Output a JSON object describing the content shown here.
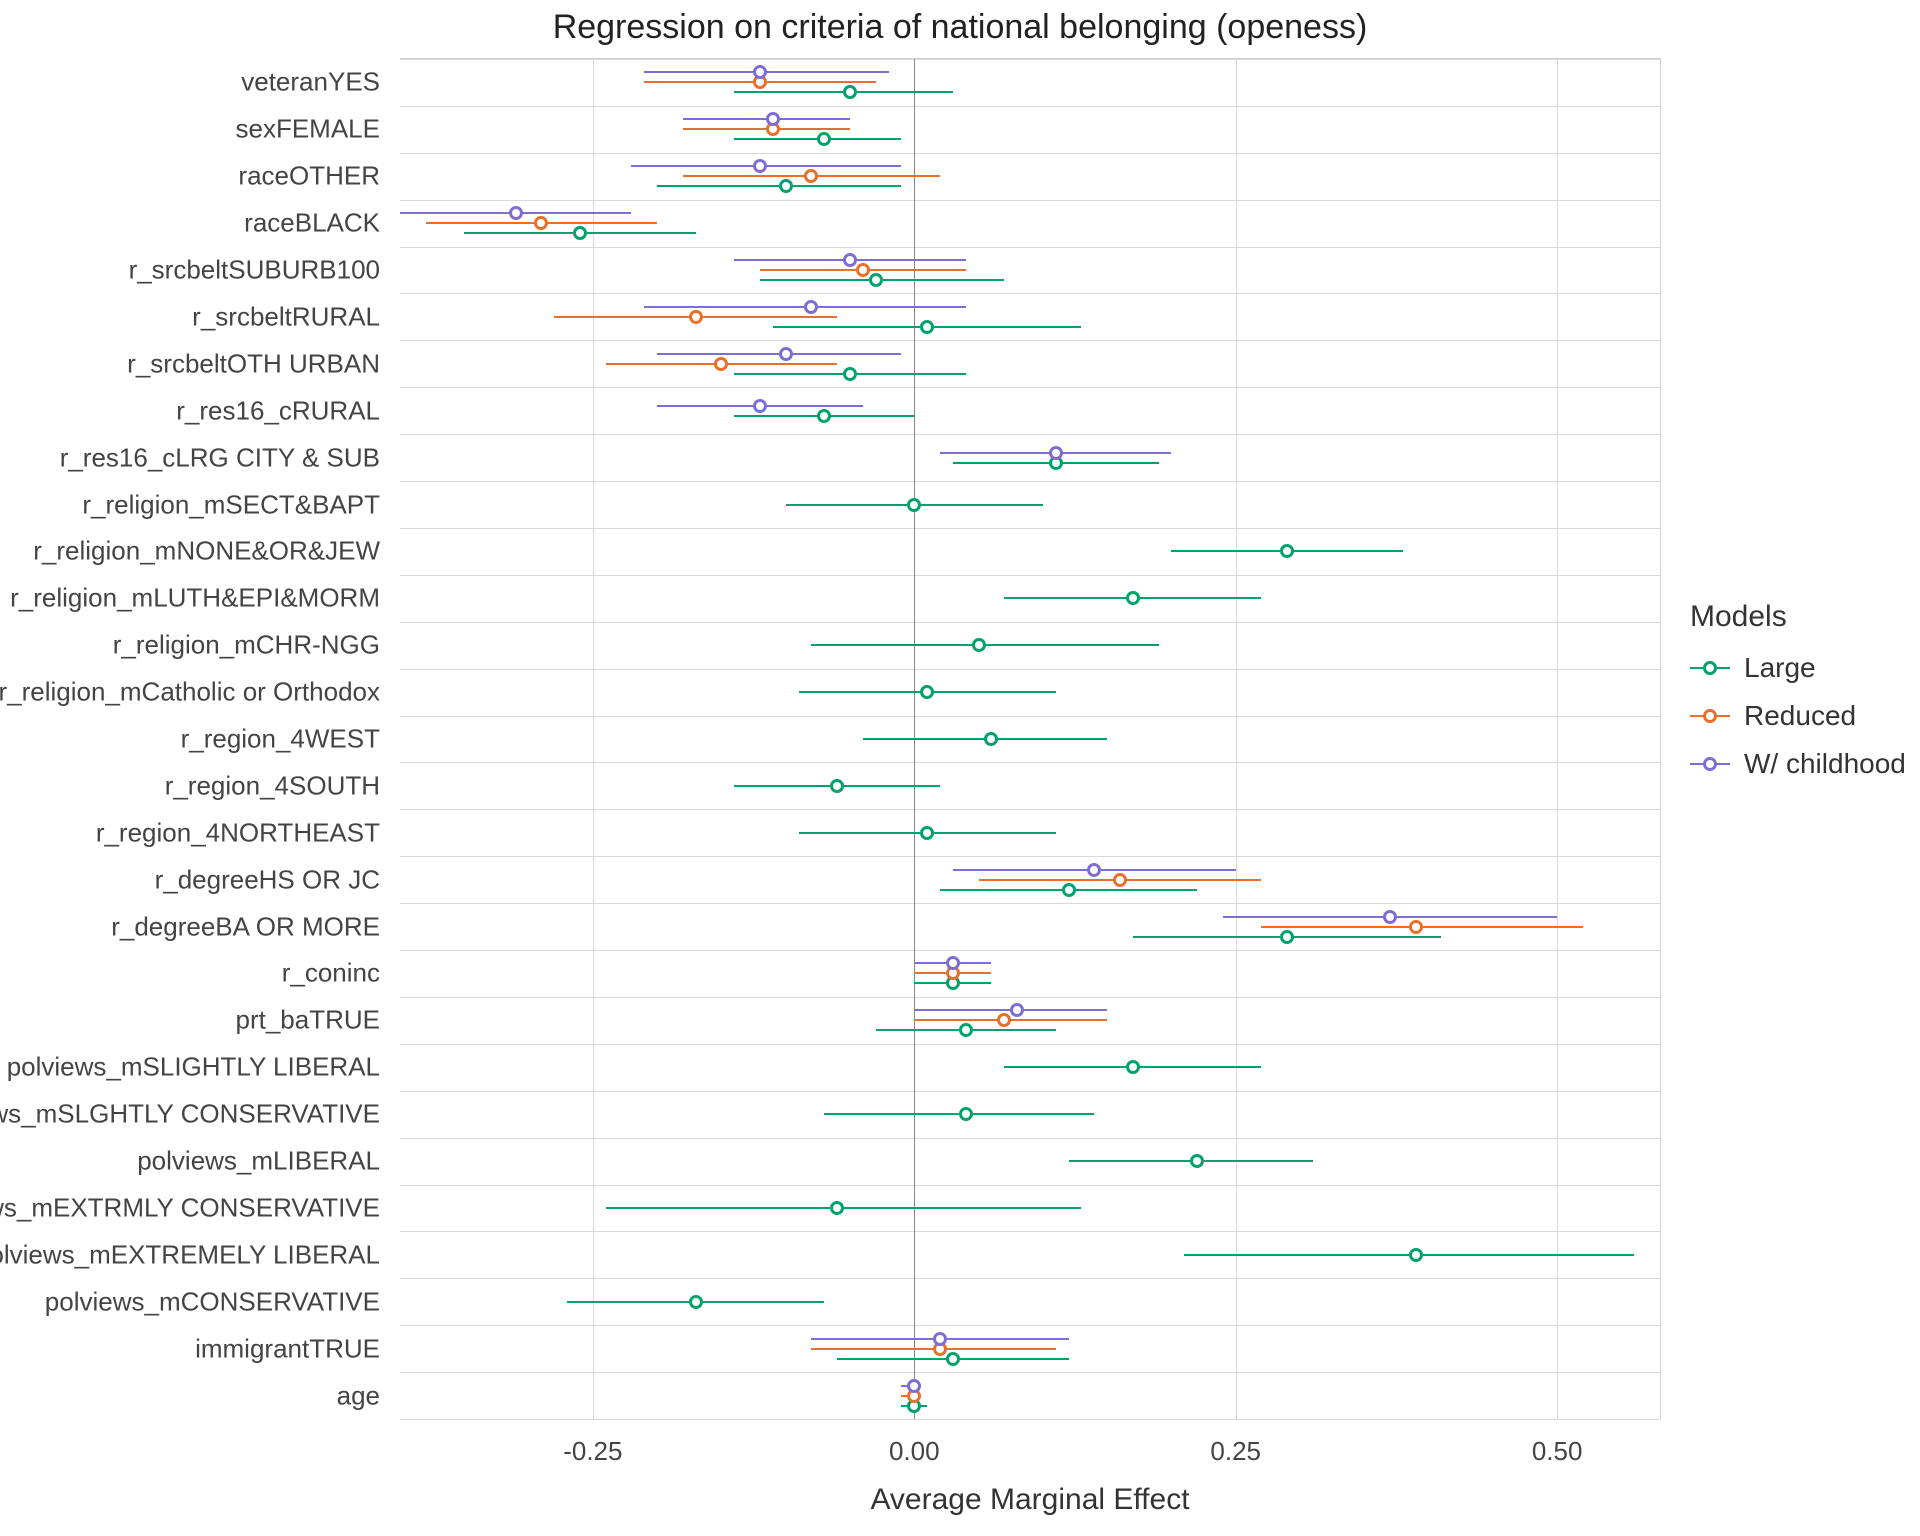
{
  "chart_data": {
    "type": "scatter",
    "title": "Regression on criteria of national belonging (openess)",
    "xlabel": "Average Marginal Effect",
    "ylabel": "",
    "xlim": [
      -0.4,
      0.58
    ],
    "x_ticks": [
      -0.25,
      0.0,
      0.25,
      0.5
    ],
    "categories": [
      "veteranYES",
      "sexFEMALE",
      "raceOTHER",
      "raceBLACK",
      "r_srcbeltSUBURB100",
      "r_srcbeltRURAL",
      "r_srcbeltOTH URBAN",
      "r_res16_cRURAL",
      "r_res16_cLRG CITY & SUB",
      "r_religion_mSECT&BAPT",
      "r_religion_mNONE&OR&JEW",
      "r_religion_mLUTH&EPI&MORM",
      "r_religion_mCHR-NGG",
      "r_religion_mCatholic or Orthodox",
      "r_region_4WEST",
      "r_region_4SOUTH",
      "r_region_4NORTHEAST",
      "r_degreeHS OR JC",
      "r_degreeBA OR MORE",
      "r_coninc",
      "prt_baTRUE",
      "polviews_mSLIGHTLY LIBERAL",
      "polviews_mSLGHTLY CONSERVATIVE",
      "polviews_mLIBERAL",
      "polviews_mEXTRMLY CONSERVATIVE",
      "polviews_mEXTREMELY LIBERAL",
      "polviews_mCONSERVATIVE",
      "immigrantTRUE",
      "age"
    ],
    "series": [
      {
        "name": "Large",
        "color": "#00a36c",
        "points": {
          "veteranYES": {
            "est": -0.05,
            "lo": -0.14,
            "hi": 0.03
          },
          "sexFEMALE": {
            "est": -0.07,
            "lo": -0.14,
            "hi": -0.01
          },
          "raceOTHER": {
            "est": -0.1,
            "lo": -0.2,
            "hi": -0.01
          },
          "raceBLACK": {
            "est": -0.26,
            "lo": -0.35,
            "hi": -0.17
          },
          "r_srcbeltSUBURB100": {
            "est": -0.03,
            "lo": -0.12,
            "hi": 0.07
          },
          "r_srcbeltRURAL": {
            "est": 0.01,
            "lo": -0.11,
            "hi": 0.13
          },
          "r_srcbeltOTH URBAN": {
            "est": -0.05,
            "lo": -0.14,
            "hi": 0.04
          },
          "r_res16_cRURAL": {
            "est": -0.07,
            "lo": -0.14,
            "hi": 0.0
          },
          "r_res16_cLRG CITY & SUB": {
            "est": 0.11,
            "lo": 0.03,
            "hi": 0.19
          },
          "r_religion_mSECT&BAPT": {
            "est": 0.0,
            "lo": -0.1,
            "hi": 0.1
          },
          "r_religion_mNONE&OR&JEW": {
            "est": 0.29,
            "lo": 0.2,
            "hi": 0.38
          },
          "r_religion_mLUTH&EPI&MORM": {
            "est": 0.17,
            "lo": 0.07,
            "hi": 0.27
          },
          "r_religion_mCHR-NGG": {
            "est": 0.05,
            "lo": -0.08,
            "hi": 0.19
          },
          "r_religion_mCatholic or Orthodox": {
            "est": 0.01,
            "lo": -0.09,
            "hi": 0.11
          },
          "r_region_4WEST": {
            "est": 0.06,
            "lo": -0.04,
            "hi": 0.15
          },
          "r_region_4SOUTH": {
            "est": -0.06,
            "lo": -0.14,
            "hi": 0.02
          },
          "r_region_4NORTHEAST": {
            "est": 0.01,
            "lo": -0.09,
            "hi": 0.11
          },
          "r_degreeHS OR JC": {
            "est": 0.12,
            "lo": 0.02,
            "hi": 0.22
          },
          "r_degreeBA OR MORE": {
            "est": 0.29,
            "lo": 0.17,
            "hi": 0.41
          },
          "r_coninc": {
            "est": 0.03,
            "lo": 0.0,
            "hi": 0.06
          },
          "prt_baTRUE": {
            "est": 0.04,
            "lo": -0.03,
            "hi": 0.11
          },
          "polviews_mSLIGHTLY LIBERAL": {
            "est": 0.17,
            "lo": 0.07,
            "hi": 0.27
          },
          "polviews_mSLGHTLY CONSERVATIVE": {
            "est": 0.04,
            "lo": -0.07,
            "hi": 0.14
          },
          "polviews_mLIBERAL": {
            "est": 0.22,
            "lo": 0.12,
            "hi": 0.31
          },
          "polviews_mEXTRMLY CONSERVATIVE": {
            "est": -0.06,
            "lo": -0.24,
            "hi": 0.13
          },
          "polviews_mEXTREMELY LIBERAL": {
            "est": 0.39,
            "lo": 0.21,
            "hi": 0.56
          },
          "polviews_mCONSERVATIVE": {
            "est": -0.17,
            "lo": -0.27,
            "hi": -0.07
          },
          "immigrantTRUE": {
            "est": 0.03,
            "lo": -0.06,
            "hi": 0.12
          },
          "age": {
            "est": 0.0,
            "lo": -0.01,
            "hi": 0.01
          }
        }
      },
      {
        "name": "Reduced",
        "color": "#e8702a",
        "points": {
          "veteranYES": {
            "est": -0.12,
            "lo": -0.21,
            "hi": -0.03
          },
          "sexFEMALE": {
            "est": -0.11,
            "lo": -0.18,
            "hi": -0.05
          },
          "raceOTHER": {
            "est": -0.08,
            "lo": -0.18,
            "hi": 0.02
          },
          "raceBLACK": {
            "est": -0.29,
            "lo": -0.38,
            "hi": -0.2
          },
          "r_srcbeltSUBURB100": {
            "est": -0.04,
            "lo": -0.12,
            "hi": 0.04
          },
          "r_srcbeltRURAL": {
            "est": -0.17,
            "lo": -0.28,
            "hi": -0.06
          },
          "r_srcbeltOTH URBAN": {
            "est": -0.15,
            "lo": -0.24,
            "hi": -0.06
          },
          "r_degreeHS OR JC": {
            "est": 0.16,
            "lo": 0.05,
            "hi": 0.27
          },
          "r_degreeBA OR MORE": {
            "est": 0.39,
            "lo": 0.27,
            "hi": 0.52
          },
          "r_coninc": {
            "est": 0.03,
            "lo": 0.0,
            "hi": 0.06
          },
          "prt_baTRUE": {
            "est": 0.07,
            "lo": 0.0,
            "hi": 0.15
          },
          "immigrantTRUE": {
            "est": 0.02,
            "lo": -0.08,
            "hi": 0.11
          },
          "age": {
            "est": 0.0,
            "lo": -0.01,
            "hi": 0.0
          }
        }
      },
      {
        "name": "W/ childhood",
        "color": "#7b6fd6",
        "points": {
          "veteranYES": {
            "est": -0.12,
            "lo": -0.21,
            "hi": -0.02
          },
          "sexFEMALE": {
            "est": -0.11,
            "lo": -0.18,
            "hi": -0.05
          },
          "raceOTHER": {
            "est": -0.12,
            "lo": -0.22,
            "hi": -0.01
          },
          "raceBLACK": {
            "est": -0.31,
            "lo": -0.4,
            "hi": -0.22
          },
          "r_srcbeltSUBURB100": {
            "est": -0.05,
            "lo": -0.14,
            "hi": 0.04
          },
          "r_srcbeltRURAL": {
            "est": -0.08,
            "lo": -0.21,
            "hi": 0.04
          },
          "r_srcbeltOTH URBAN": {
            "est": -0.1,
            "lo": -0.2,
            "hi": -0.01
          },
          "r_res16_cRURAL": {
            "est": -0.12,
            "lo": -0.2,
            "hi": -0.04
          },
          "r_res16_cLRG CITY & SUB": {
            "est": 0.11,
            "lo": 0.02,
            "hi": 0.2
          },
          "r_degreeHS OR JC": {
            "est": 0.14,
            "lo": 0.03,
            "hi": 0.25
          },
          "r_degreeBA OR MORE": {
            "est": 0.37,
            "lo": 0.24,
            "hi": 0.5
          },
          "r_coninc": {
            "est": 0.03,
            "lo": 0.0,
            "hi": 0.06
          },
          "prt_baTRUE": {
            "est": 0.08,
            "lo": 0.0,
            "hi": 0.15
          },
          "immigrantTRUE": {
            "est": 0.02,
            "lo": -0.08,
            "hi": 0.12
          },
          "age": {
            "est": 0.0,
            "lo": -0.01,
            "hi": 0.0
          }
        }
      }
    ],
    "legend_title": "Models"
  }
}
